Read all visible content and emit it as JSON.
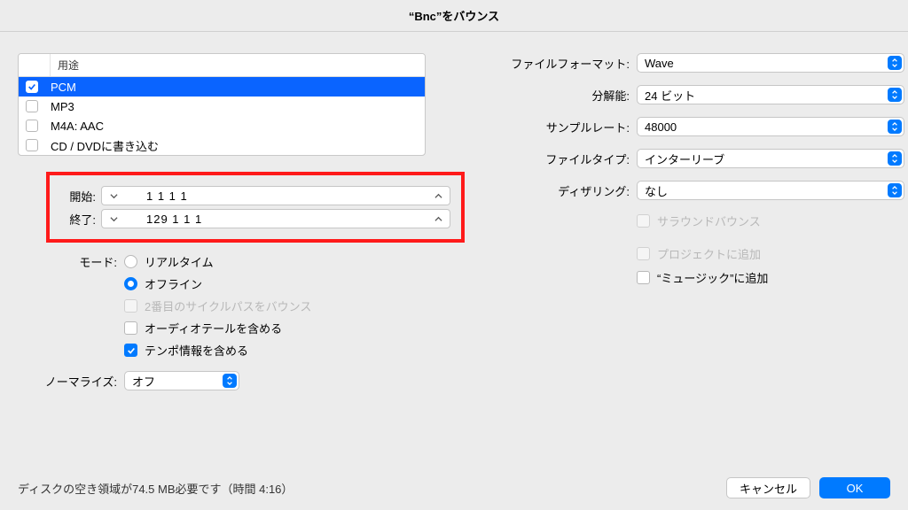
{
  "title": "“Bnc”をバウンス",
  "list": {
    "header": "用途",
    "items": [
      {
        "label": "PCM",
        "checked": true,
        "selected": true
      },
      {
        "label": "MP3",
        "checked": false,
        "selected": false
      },
      {
        "label": "M4A: AAC",
        "checked": false,
        "selected": false
      },
      {
        "label": "CD / DVDに書き込む",
        "checked": false,
        "selected": false
      }
    ]
  },
  "range": {
    "start_label": "開始:",
    "end_label": "終了:",
    "start_value": "1 1 1     1",
    "end_value": "129 1 1     1"
  },
  "mode": {
    "label": "モード:",
    "realtime": "リアルタイム",
    "offline": "オフライン",
    "second_cycle": "2番目のサイクルパスをバウンス",
    "include_tail": "オーディオテールを含める",
    "include_tempo": "テンポ情報を含める"
  },
  "normalize": {
    "label": "ノーマライズ:",
    "value": "オフ"
  },
  "format": {
    "file_format_label": "ファイルフォーマット:",
    "file_format_value": "Wave",
    "resolution_label": "分解能:",
    "resolution_value": "24 ビット",
    "sample_rate_label": "サンプルレート:",
    "sample_rate_value": "48000",
    "file_type_label": "ファイルタイプ:",
    "file_type_value": "インターリーブ",
    "dithering_label": "ディザリング:",
    "dithering_value": "なし"
  },
  "right_checks": {
    "surround": "サラウンドバウンス",
    "add_project": "プロジェクトに追加",
    "add_music": "“ミュージック”に追加"
  },
  "footer": {
    "disk": "ディスクの空き領域が74.5 MB必要です（時間 4:16）",
    "cancel": "キャンセル",
    "ok": "OK"
  }
}
